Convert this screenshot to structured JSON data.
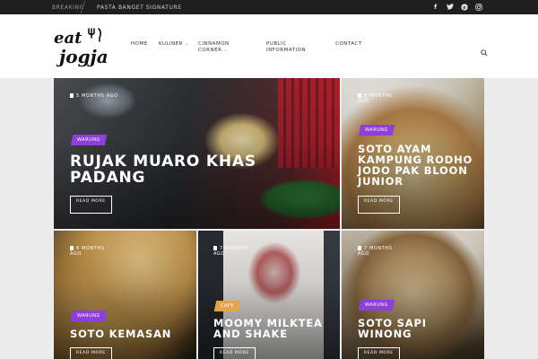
{
  "topbar": {
    "breaking_label": "Breaking",
    "ticker_text": "Pasta Banget Signature",
    "social": [
      {
        "icon": "facebook-icon",
        "glyph": "f"
      },
      {
        "icon": "twitter-icon",
        "glyph": "t"
      },
      {
        "icon": "pinterest-icon",
        "glyph": "p"
      },
      {
        "icon": "instagram-icon",
        "glyph": "◎"
      }
    ]
  },
  "header": {
    "logo_text": "eat jogja",
    "nav": [
      {
        "label": "Home",
        "has_dropdown": false
      },
      {
        "label": "Kuliner",
        "has_dropdown": true
      },
      {
        "label": "Cinnamon Corner",
        "has_dropdown": true
      },
      {
        "label": "Public Information",
        "has_dropdown": false
      },
      {
        "label": "Contact",
        "has_dropdown": false
      }
    ]
  },
  "posts": [
    {
      "time": "5 months ago",
      "category": "Warung",
      "title": "Rujak Muaro Khas Padang",
      "read_more": "Read more",
      "badge_color": "#8e3fd8"
    },
    {
      "time": "5 months ago",
      "category": "Warung",
      "title": "Soto Ayam Kampung Rodho Jodo Pak Bloon Junior",
      "read_more": "Read more",
      "badge_color": "#8e3fd8"
    },
    {
      "time": "6 months ago",
      "category": "Warung",
      "title": "Soto Kemasan",
      "read_more": "Read more",
      "badge_color": "#8e3fd8"
    },
    {
      "time": "7 months ago",
      "category": "Cafe",
      "title": "Moomy Milktea and Shake",
      "read_more": "Read more",
      "badge_color": "#e5a34a"
    },
    {
      "time": "7 months ago",
      "category": "Warung",
      "title": "Soto Sapi Winong",
      "read_more": "Read more",
      "badge_color": "#8e3fd8"
    }
  ]
}
